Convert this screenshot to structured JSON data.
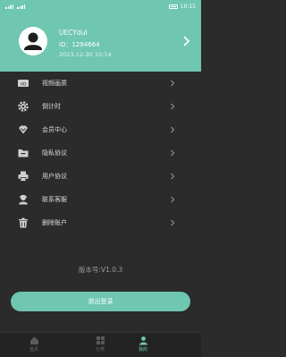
{
  "status": {
    "left_text": "ull ull",
    "time": "10:15"
  },
  "profile": {
    "name": "UECYdul",
    "id": "ID：1294664",
    "time": "2023-12-30 10:14"
  },
  "menu": {
    "items": [
      {
        "label": "视频画质",
        "icon": "video-quality-icon"
      },
      {
        "label": "倒计时",
        "icon": "gear-icon"
      },
      {
        "label": "会员中心",
        "icon": "diamond-icon"
      },
      {
        "label": "隐私协议",
        "icon": "privacy-folder-icon"
      },
      {
        "label": "用户协议",
        "icon": "printer-icon"
      },
      {
        "label": "联系客服",
        "icon": "customer-service-icon"
      },
      {
        "label": "删除账户",
        "icon": "trash-icon"
      }
    ]
  },
  "version": "版本号:V1.0.3",
  "logout_label": "退出登录",
  "tabbar": {
    "tabs": [
      {
        "label": "首页",
        "icon": "home-icon"
      },
      {
        "label": "分类",
        "icon": "grid-icon"
      },
      {
        "label": "我的",
        "icon": "user-icon"
      }
    ]
  },
  "colors": {
    "accent": "#6fc6b1",
    "background": "#2b2b2b"
  }
}
